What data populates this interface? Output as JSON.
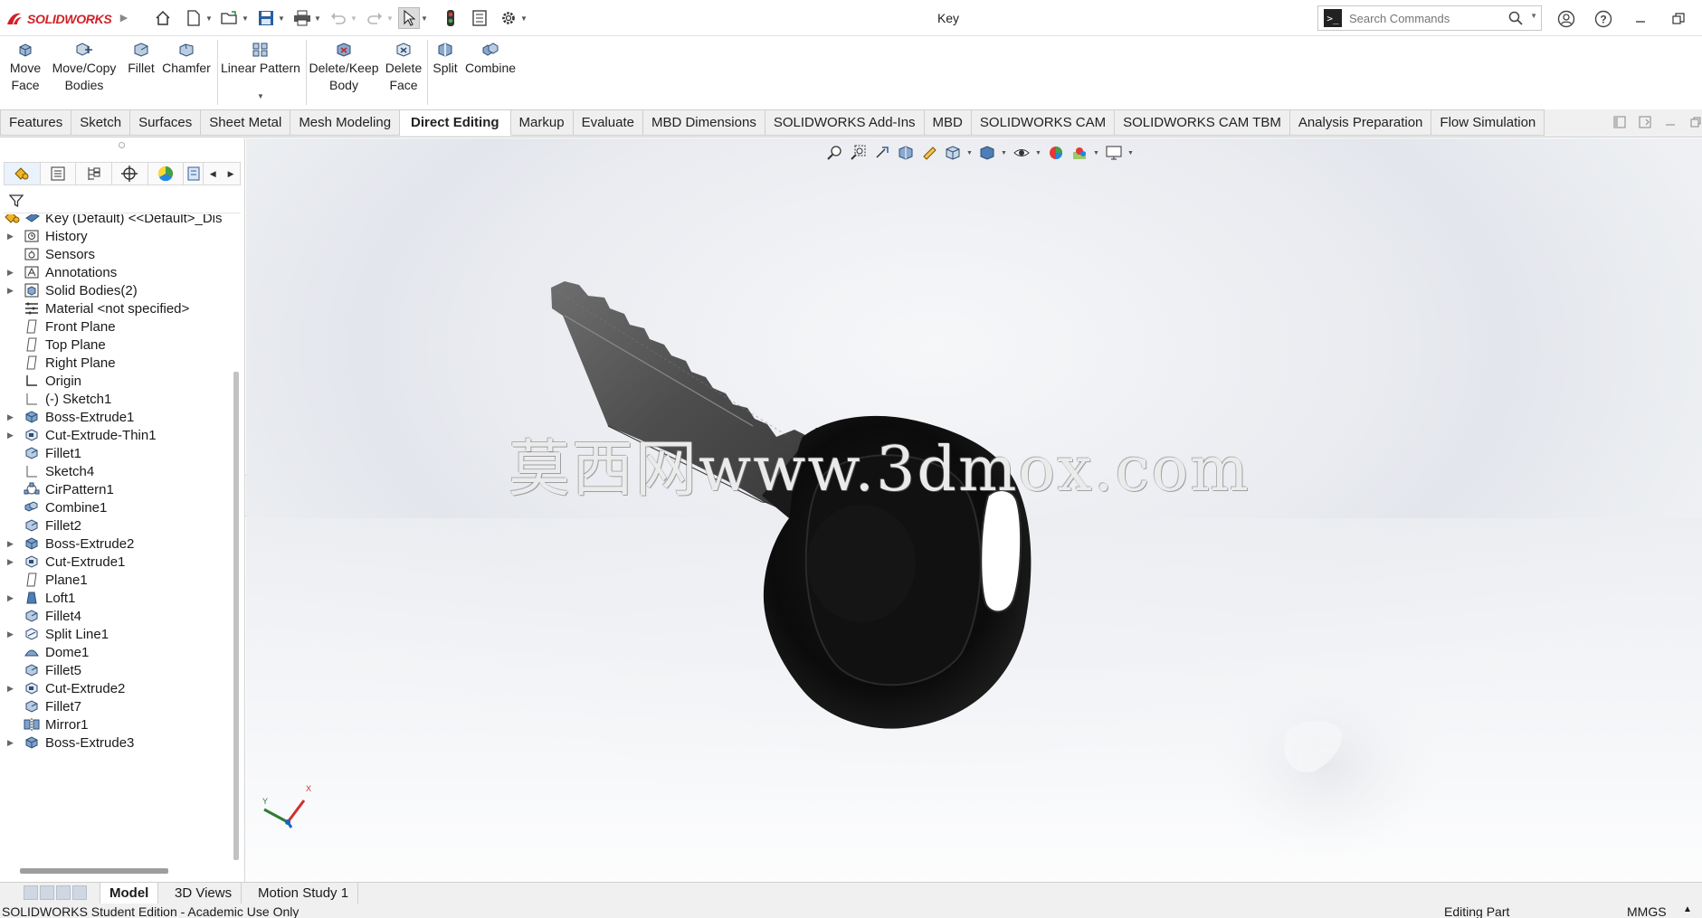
{
  "app": {
    "brand": "SOLIDWORKS",
    "document_title": "Key"
  },
  "search": {
    "placeholder": "Search Commands"
  },
  "command_manager": {
    "move_face": "Move\nFace",
    "move_face_l1": "Move",
    "move_face_l2": "Face",
    "move_copy_l1": "Move/Copy",
    "move_copy_l2": "Bodies",
    "fillet": "Fillet",
    "chamfer": "Chamfer",
    "linear_pattern": "Linear Pattern",
    "delete_keep_l1": "Delete/Keep",
    "delete_keep_l2": "Body",
    "delete_face_l1": "Delete",
    "delete_face_l2": "Face",
    "split": "Split",
    "combine": "Combine"
  },
  "tabs": [
    "Features",
    "Sketch",
    "Surfaces",
    "Sheet Metal",
    "Mesh Modeling",
    "Direct Editing",
    "Markup",
    "Evaluate",
    "MBD Dimensions",
    "SOLIDWORKS Add-Ins",
    "MBD",
    "SOLIDWORKS CAM",
    "SOLIDWORKS CAM TBM",
    "Analysis Preparation",
    "Flow Simulation"
  ],
  "active_tab": "Direct Editing",
  "feature_tree": {
    "root": "Key (Default) <<Default>_Dis",
    "items": [
      {
        "label": "History",
        "icon": "history-icon",
        "expandable": true
      },
      {
        "label": "Sensors",
        "icon": "sensors-icon",
        "expandable": false
      },
      {
        "label": "Annotations",
        "icon": "annotations-icon",
        "expandable": true
      },
      {
        "label": "Solid Bodies(2)",
        "icon": "solid-bodies-icon",
        "expandable": true
      },
      {
        "label": "Material <not specified>",
        "icon": "material-icon",
        "expandable": false
      },
      {
        "label": "Front Plane",
        "icon": "plane-icon",
        "expandable": false
      },
      {
        "label": "Top Plane",
        "icon": "plane-icon",
        "expandable": false
      },
      {
        "label": "Right Plane",
        "icon": "plane-icon",
        "expandable": false
      },
      {
        "label": "Origin",
        "icon": "origin-icon",
        "expandable": false
      },
      {
        "label": "(-) Sketch1",
        "icon": "sketch-icon",
        "expandable": false
      },
      {
        "label": "Boss-Extrude1",
        "icon": "boss-extrude-icon",
        "expandable": true
      },
      {
        "label": "Cut-Extrude-Thin1",
        "icon": "cut-extrude-icon",
        "expandable": true
      },
      {
        "label": "Fillet1",
        "icon": "fillet-icon",
        "expandable": false
      },
      {
        "label": "Sketch4",
        "icon": "sketch-icon",
        "expandable": false
      },
      {
        "label": "CirPattern1",
        "icon": "cirpattern-icon",
        "expandable": false
      },
      {
        "label": "Combine1",
        "icon": "combine-icon",
        "expandable": false
      },
      {
        "label": "Fillet2",
        "icon": "fillet-icon",
        "expandable": false
      },
      {
        "label": "Boss-Extrude2",
        "icon": "boss-extrude-icon",
        "expandable": true
      },
      {
        "label": "Cut-Extrude1",
        "icon": "cut-extrude-icon",
        "expandable": true
      },
      {
        "label": "Plane1",
        "icon": "plane-icon",
        "expandable": false
      },
      {
        "label": "Loft1",
        "icon": "loft-icon",
        "expandable": true
      },
      {
        "label": "Fillet4",
        "icon": "fillet-icon",
        "expandable": false
      },
      {
        "label": "Split Line1",
        "icon": "split-line-icon",
        "expandable": true
      },
      {
        "label": "Dome1",
        "icon": "dome-icon",
        "expandable": false
      },
      {
        "label": "Fillet5",
        "icon": "fillet-icon",
        "expandable": false
      },
      {
        "label": "Cut-Extrude2",
        "icon": "cut-extrude-icon",
        "expandable": true
      },
      {
        "label": "Fillet7",
        "icon": "fillet-icon",
        "expandable": false
      },
      {
        "label": "Mirror1",
        "icon": "mirror-icon",
        "expandable": false
      },
      {
        "label": "Boss-Extrude3",
        "icon": "boss-extrude-icon",
        "expandable": true
      }
    ]
  },
  "viewport": {
    "watermark": "莫西网www.3dmox.com",
    "triad_x": "X",
    "triad_y": "Y"
  },
  "bottom_tabs": [
    "Model",
    "3D Views",
    "Motion Study 1"
  ],
  "active_bottom_tab": "Model",
  "status": {
    "left": "SOLIDWORKS Student Edition - Academic Use Only",
    "mode": "Editing Part",
    "units": "MMGS"
  },
  "colors": {
    "brand_red": "#d02127",
    "accent_blue": "#1f6fc4",
    "key_black": "#0e0e0e",
    "blade_gray": "#4a4a4a"
  }
}
